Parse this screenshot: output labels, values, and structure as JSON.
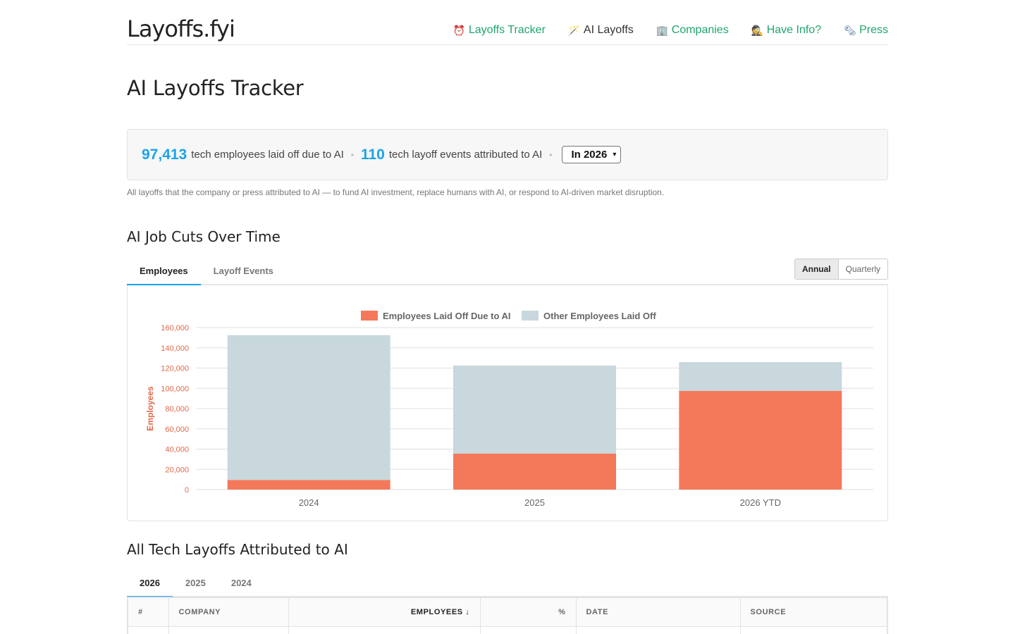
{
  "header": {
    "logo": "Layoffs.fyi",
    "nav": [
      {
        "label": "Layoffs Tracker",
        "icon": "⏰",
        "icon_name": "alarm-clock-icon"
      },
      {
        "label": "AI Layoffs",
        "icon": "🪄",
        "icon_name": "magic-wand-icon"
      },
      {
        "label": "Companies",
        "icon": "🏢",
        "icon_name": "office-building-icon"
      },
      {
        "label": "Have Info?",
        "icon": "🕵",
        "icon_name": "spy-icon"
      },
      {
        "label": "Press",
        "icon": "🗞",
        "icon_name": "newspaper-icon"
      }
    ]
  },
  "page_title": "AI Layoffs Tracker",
  "stats": {
    "employees_num": "97,413",
    "employees_text": "tech employees laid off due to AI",
    "events_num": "110",
    "events_text": "tech layoff events attributed to AI",
    "year_select": "In 2026"
  },
  "note": "All layoffs that the company or press attributed to AI — to fund AI investment, replace humans with AI, or respond to AI-driven market disruption.",
  "chart_section": {
    "title": "AI Job Cuts Over Time",
    "tabs": [
      "Employees",
      "Layoff Events"
    ],
    "period": [
      "Annual",
      "Quarterly"
    ]
  },
  "chart_data": {
    "type": "bar",
    "stacked": true,
    "categories": [
      "2024",
      "2025",
      "2026 YTD"
    ],
    "series": [
      {
        "name": "Employees Laid Off Due to AI",
        "values": [
          9500,
          35500,
          97413
        ],
        "color": "#f4795b"
      },
      {
        "name": "Other Employees Laid Off",
        "values": [
          143000,
          87000,
          28500
        ],
        "color": "#c8d8dc"
      }
    ],
    "ylabel": "Employees",
    "ylim": [
      0,
      160000
    ],
    "yticks": [
      "0",
      "20,000",
      "40,000",
      "60,000",
      "80,000",
      "100,000",
      "120,000",
      "140,000",
      "160,000"
    ],
    "ytick_values": [
      0,
      20000,
      40000,
      60000,
      80000,
      100000,
      120000,
      140000,
      160000
    ],
    "grid": true,
    "legend_position": "top-center"
  },
  "table_section": {
    "title": "All Tech Layoffs Attributed to AI",
    "tabs": [
      "2026",
      "2025",
      "2024"
    ],
    "columns": [
      "#",
      "COMPANY",
      "EMPLOYEES ↓",
      "%",
      "DATE",
      "SOURCE"
    ]
  },
  "colors": {
    "accent_blue": "#1aa3e8",
    "nav_green": "#1fa66b",
    "ai_bar": "#f4795b",
    "other_bar": "#c8d8dc"
  }
}
